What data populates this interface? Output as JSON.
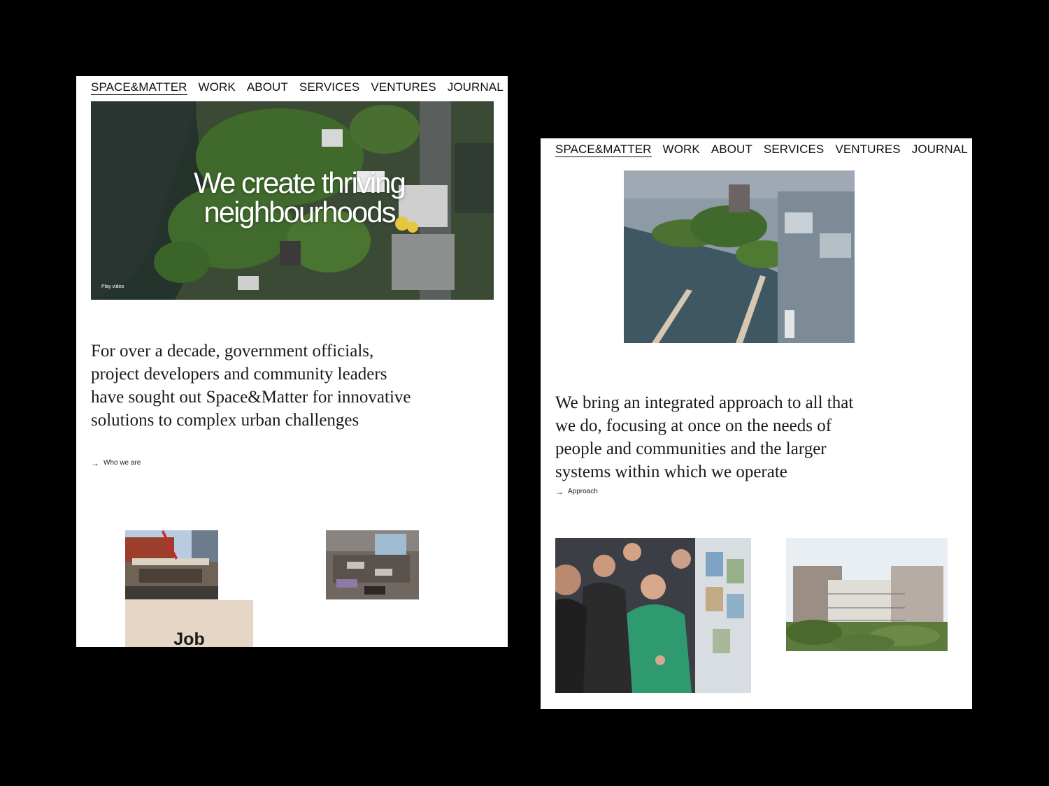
{
  "left_page": {
    "nav": {
      "logo": "SPACE&MATTER",
      "items": [
        "WORK",
        "ABOUT",
        "SERVICES",
        "VENTURES",
        "JOURNAL"
      ]
    },
    "hero": {
      "title": "We create thriving neighbourhoods",
      "play_label": "Play video"
    },
    "intro": "For over a decade, government officials, project developers and community leaders have sought out Space&Matter for innovative solutions to complex urban challenges",
    "link_label": "Who we are",
    "job_card_label": "Job"
  },
  "right_page": {
    "nav": {
      "logo": "SPACE&MATTER",
      "items": [
        "WORK",
        "ABOUT",
        "SERVICES",
        "VENTURES",
        "JOURNAL"
      ]
    },
    "intro": "We bring an integrated approach to all that we do, focusing at once on the needs of people and communities and the larger systems within which we operate",
    "link_label": "Approach"
  }
}
